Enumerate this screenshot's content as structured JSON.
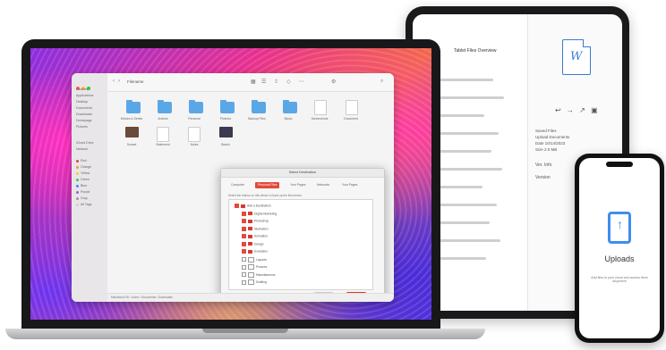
{
  "tablet": {
    "file_title": "Tablet Files Overview",
    "doc_letter": "W",
    "tools": "↩ → ↗ ▣",
    "details": [
      "Saved Files",
      "Upload Documents",
      "Date 10/14/2023",
      "Size 2.0 MB"
    ],
    "section1": "Ver. Info",
    "section2": "Version"
  },
  "laptop": {
    "finder": {
      "title": "Filename",
      "sidebar_favorites": [
        "Recents",
        "Applications",
        "Desktop",
        "Documents",
        "Downloads",
        "Homepage",
        "Pictures"
      ],
      "sidebar_locations_header": "iCloud Drive",
      "sidebar_locations": [
        "Network"
      ],
      "tags": [
        {
          "label": "Red",
          "color": "#e2453a"
        },
        {
          "label": "Orange",
          "color": "#f29b2e"
        },
        {
          "label": "Yellow",
          "color": "#f2cf2e"
        },
        {
          "label": "Green",
          "color": "#4cbf56"
        },
        {
          "label": "Blue",
          "color": "#3c8ef0"
        },
        {
          "label": "Purple",
          "color": "#a45bd8"
        },
        {
          "label": "Gray",
          "color": "#9a9a9a"
        },
        {
          "label": "All Tags",
          "color": "#cccccc"
        }
      ],
      "items_row1": [
        "Movies & Series",
        "Archive",
        "Personal",
        "Pictures",
        "Backup Files",
        "Music",
        "Screenshots",
        "Document"
      ],
      "items_row2": [
        "Sunset",
        "Statement",
        "Notes",
        "Beach"
      ],
      "statusbar": "Macintosh HD › Users › Documents › Downloads"
    },
    "dialog": {
      "title": "Select Destination",
      "tabs": [
        "Computer",
        "Personal Files",
        "Your Pages",
        "Networks",
        "Your Pages"
      ],
      "active_tab": 1,
      "hint": "Select the folders on this device to back up the files below",
      "tree": [
        {
          "label": "Add a Destination",
          "checked": true,
          "kind": "red",
          "indent": 0
        },
        {
          "label": "Digital Marketing",
          "checked": true,
          "kind": "red",
          "indent": 1
        },
        {
          "label": "Photoshop",
          "checked": true,
          "kind": "red",
          "indent": 1
        },
        {
          "label": "Illustration",
          "checked": true,
          "kind": "red",
          "indent": 1
        },
        {
          "label": "Animation",
          "checked": true,
          "kind": "red",
          "indent": 1
        },
        {
          "label": "Design",
          "checked": true,
          "kind": "red",
          "indent": 1
        },
        {
          "label": "Examples",
          "checked": true,
          "kind": "red",
          "indent": 1
        },
        {
          "label": "Layouts",
          "checked": false,
          "kind": "gray",
          "indent": 1
        },
        {
          "label": "Pictures",
          "checked": false,
          "kind": "gray",
          "indent": 1
        },
        {
          "label": "Miscellaneous",
          "checked": false,
          "kind": "gray",
          "indent": 1
        },
        {
          "label": "Drafting",
          "checked": false,
          "kind": "gray",
          "indent": 1
        }
      ],
      "footer": "Include this computer to back up your selected files and tags",
      "cancel_label": "Cancel",
      "ok_label": "Continue"
    }
  },
  "phone": {
    "label": "Uploads",
    "sub": "Add files to your cloud and access them anywhere"
  }
}
